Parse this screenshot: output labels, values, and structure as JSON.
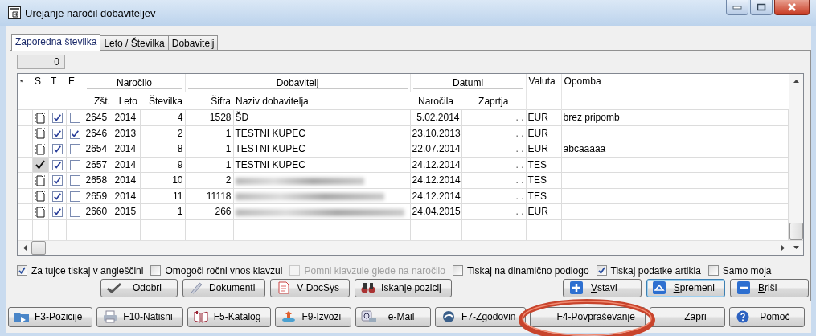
{
  "window": {
    "title": "Urejanje naročil dobaviteljev"
  },
  "tabs": [
    {
      "label": "Zaporedna številka",
      "selected": true
    },
    {
      "label": "Leto / Številka",
      "selected": false
    },
    {
      "label": "Dobavitelj",
      "selected": false
    }
  ],
  "counter": {
    "value": "0"
  },
  "table": {
    "marker": "*",
    "left_columns": [
      "S",
      "T",
      "E"
    ],
    "groups": [
      {
        "label": "Naročilo",
        "columns": [
          "Zšt.",
          "Leto",
          "Številka"
        ]
      },
      {
        "label": "Dobavitelj",
        "columns": [
          "Šifra",
          "Naziv dobavitelja"
        ]
      },
      {
        "label": "Datumi",
        "columns": [
          "Naročila",
          "Zaprtja"
        ]
      }
    ],
    "right_columns": [
      "Valuta",
      "Opomba"
    ],
    "rows": [
      {
        "approved": false,
        "t": true,
        "e": false,
        "zst": "2645",
        "leto": "2014",
        "stevilka": "4",
        "sifra": "1528",
        "naziv": "ŠD",
        "narocila": "5.02.2014",
        "zaprtja": ". .",
        "valuta": "EUR",
        "opomba": "brez pripomb"
      },
      {
        "approved": false,
        "t": true,
        "e": true,
        "zst": "2646",
        "leto": "2013",
        "stevilka": "2",
        "sifra": "1",
        "naziv": "TESTNI KUPEC",
        "narocila": "23.10.2013",
        "zaprtja": ". .",
        "valuta": "EUR"
      },
      {
        "approved": false,
        "t": true,
        "e": false,
        "zst": "2654",
        "leto": "2014",
        "stevilka": "8",
        "sifra": "1",
        "naziv": "TESTNI KUPEC",
        "narocila": "22.07.2014",
        "zaprtja": ". .",
        "valuta": "EUR",
        "opomba": "abcaaaaa"
      },
      {
        "approved": true,
        "t": true,
        "e": false,
        "zst": "2657",
        "leto": "2014",
        "stevilka": "9",
        "sifra": "1",
        "naziv": "TESTNI KUPEC",
        "narocila": "24.12.2014",
        "zaprtja": ". .",
        "valuta": "TES"
      },
      {
        "approved": false,
        "t": true,
        "e": false,
        "zst": "2658",
        "leto": "2014",
        "stevilka": "10",
        "sifra": "2",
        "naziv_blurred": true,
        "narocila": "24.12.2014",
        "zaprtja": ". .",
        "valuta": "TES"
      },
      {
        "approved": false,
        "t": true,
        "e": false,
        "zst": "2659",
        "leto": "2014",
        "stevilka": "11",
        "sifra": "11118",
        "naziv_blurred": true,
        "narocila": "24.12.2014",
        "zaprtja": ". .",
        "valuta": "TES"
      },
      {
        "approved": false,
        "t": true,
        "e": false,
        "zst": "2660",
        "leto": "2015",
        "stevilka": "1",
        "sifra": "266",
        "naziv_blurred": true,
        "narocila": "24.04.2015",
        "zaprtja": ". .",
        "valuta": "EUR"
      }
    ]
  },
  "options": [
    {
      "label": "Za tujce tiskaj v angleščini",
      "checked": true,
      "disabled": false
    },
    {
      "label": "Omogoči ročni vnos klavzul",
      "checked": false,
      "disabled": false
    },
    {
      "label": "Pomni klavzule glede na naročilo",
      "checked": false,
      "disabled": true
    },
    {
      "label": "Tiskaj na dinamično podlogo",
      "checked": false,
      "disabled": false
    },
    {
      "label": "Tiskaj podatke artikla",
      "checked": true,
      "disabled": false
    },
    {
      "label": "Samo moja",
      "checked": false,
      "disabled": false
    }
  ],
  "action_buttons": [
    {
      "label": "Odobri",
      "kind": "check"
    },
    {
      "label": "Dokumenti",
      "kind": "pen"
    },
    {
      "label": "V DocSys",
      "kind": "pdf"
    },
    {
      "label": "Iskanje pozicij",
      "kind": "binoculars"
    }
  ],
  "edit_buttons": [
    {
      "label": "Vstavi",
      "kind": "plus",
      "mnemonic": true,
      "focused": false
    },
    {
      "label": "Spremeni",
      "kind": "up",
      "mnemonic": true,
      "focused": true
    },
    {
      "label": "Briši",
      "kind": "minus",
      "mnemonic": true,
      "focused": false
    }
  ],
  "bottom_buttons": [
    {
      "label": "F3-Pozicije",
      "kind": "folder",
      "highlighted": false
    },
    {
      "label": "F10-Natisni",
      "kind": "printer",
      "highlighted": false
    },
    {
      "label": "F5-Katalog",
      "kind": "book",
      "highlighted": false
    },
    {
      "label": "F9-Izvozi",
      "kind": "export",
      "highlighted": false
    },
    {
      "label": "e-Mail",
      "kind": "mail",
      "highlighted": false
    },
    {
      "label": "F7-Zgodovin",
      "kind": "globe",
      "highlighted": false
    },
    {
      "label": "F4-Povpraševanje",
      "highlighted": true
    },
    {
      "label": "Zapri",
      "highlighted": false
    },
    {
      "label": "Pomoč",
      "kind": "help",
      "highlighted": false
    }
  ]
}
